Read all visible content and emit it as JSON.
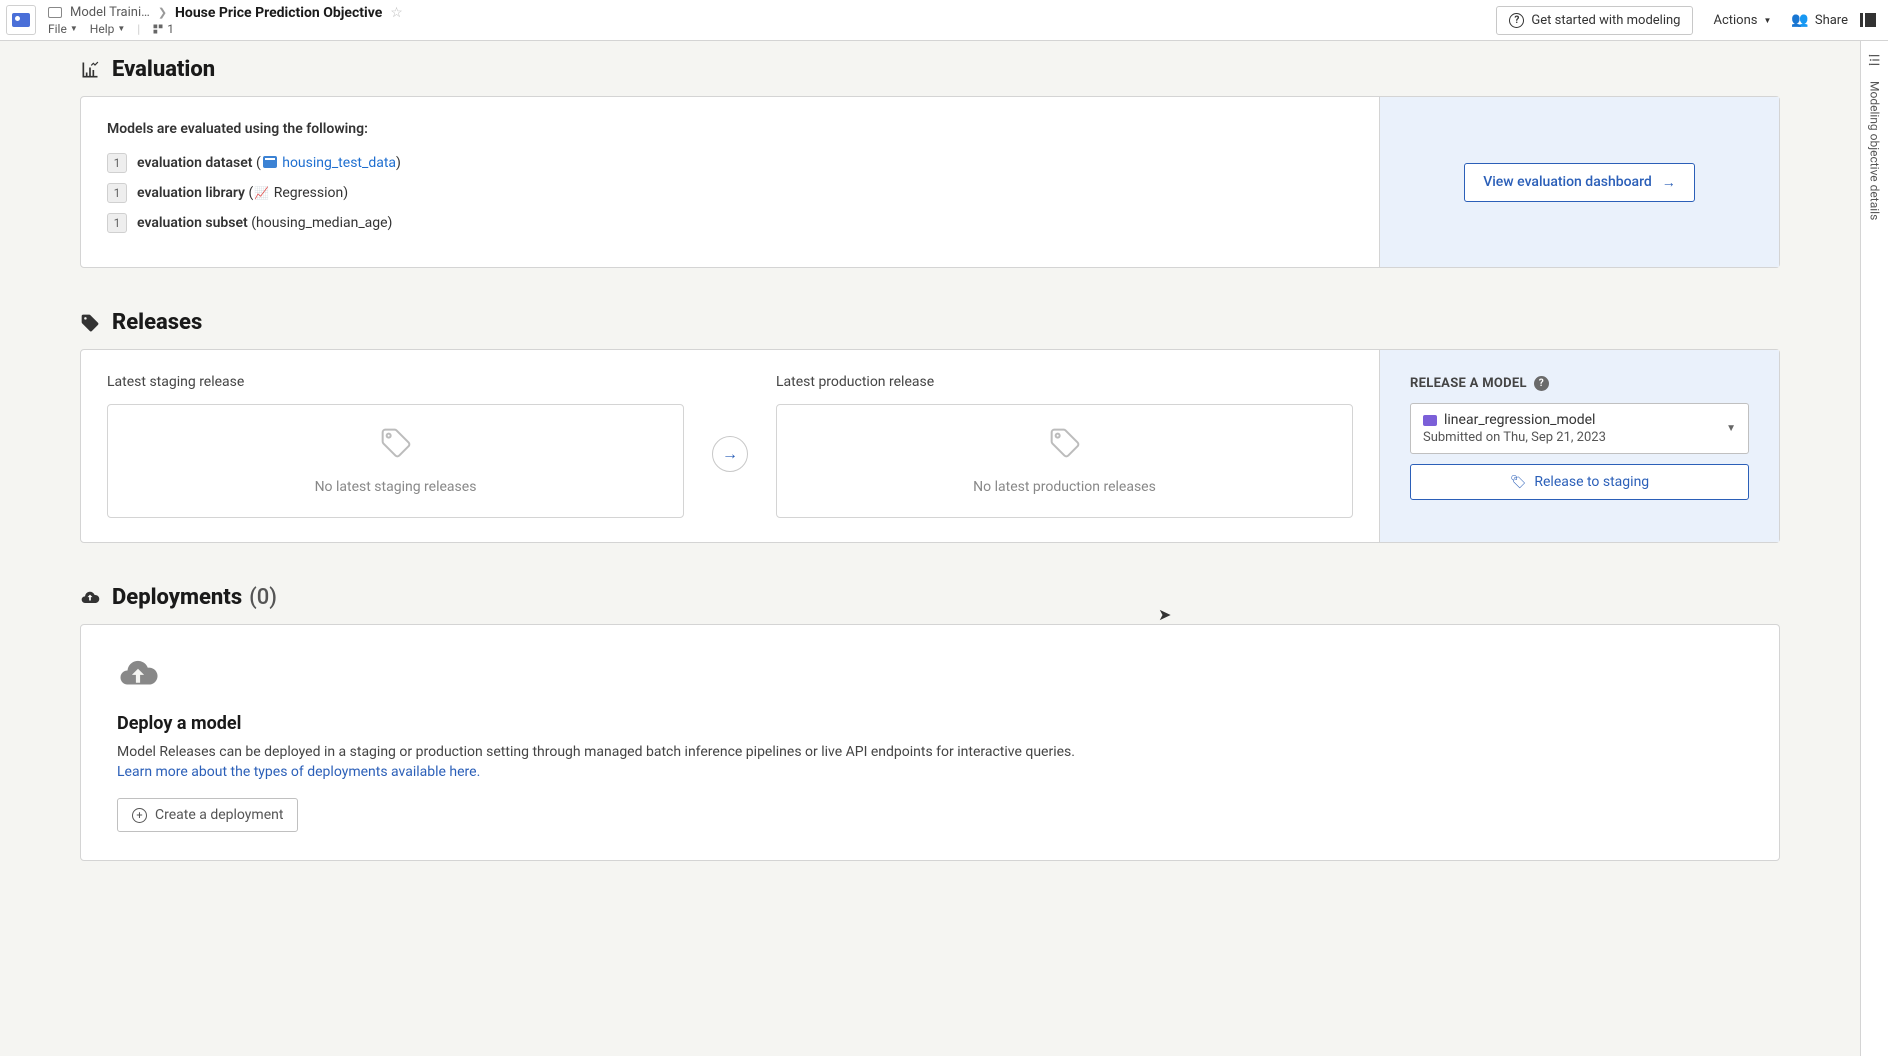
{
  "header": {
    "breadcrumb_parent": "Model Traini…",
    "breadcrumb_title": "House Price Prediction Objective",
    "menu_file": "File",
    "menu_help": "Help",
    "branch_count": "1",
    "get_started": "Get started with modeling",
    "actions": "Actions",
    "share": "Share"
  },
  "rail": {
    "label": "Modeling objective details"
  },
  "evaluation": {
    "title": "Evaluation",
    "intro": "Models are evaluated using the following:",
    "rows": {
      "dataset": {
        "count": "1",
        "label": "evaluation dataset",
        "link": "housing_test_data"
      },
      "library": {
        "count": "1",
        "label": "evaluation library",
        "value": "Regression"
      },
      "subset": {
        "count": "1",
        "label": "evaluation subset",
        "value": "housing_median_age"
      }
    },
    "dashboard_btn": "View evaluation dashboard"
  },
  "releases": {
    "title": "Releases",
    "staging_title": "Latest staging release",
    "staging_empty": "No latest staging releases",
    "production_title": "Latest production release",
    "production_empty": "No latest production releases",
    "side_title": "RELEASE A MODEL",
    "model_name": "linear_regression_model",
    "model_sub": "Submitted on Thu, Sep 21, 2023",
    "release_btn": "Release to staging"
  },
  "deployments": {
    "title": "Deployments",
    "count": "(0)",
    "card_title": "Deploy a model",
    "card_desc": "Model Releases can be deployed in a staging or production setting through managed batch inference pipelines or live API endpoints for interactive queries.",
    "card_link": "Learn more about the types of deployments available here.",
    "create_btn": "Create a deployment"
  }
}
